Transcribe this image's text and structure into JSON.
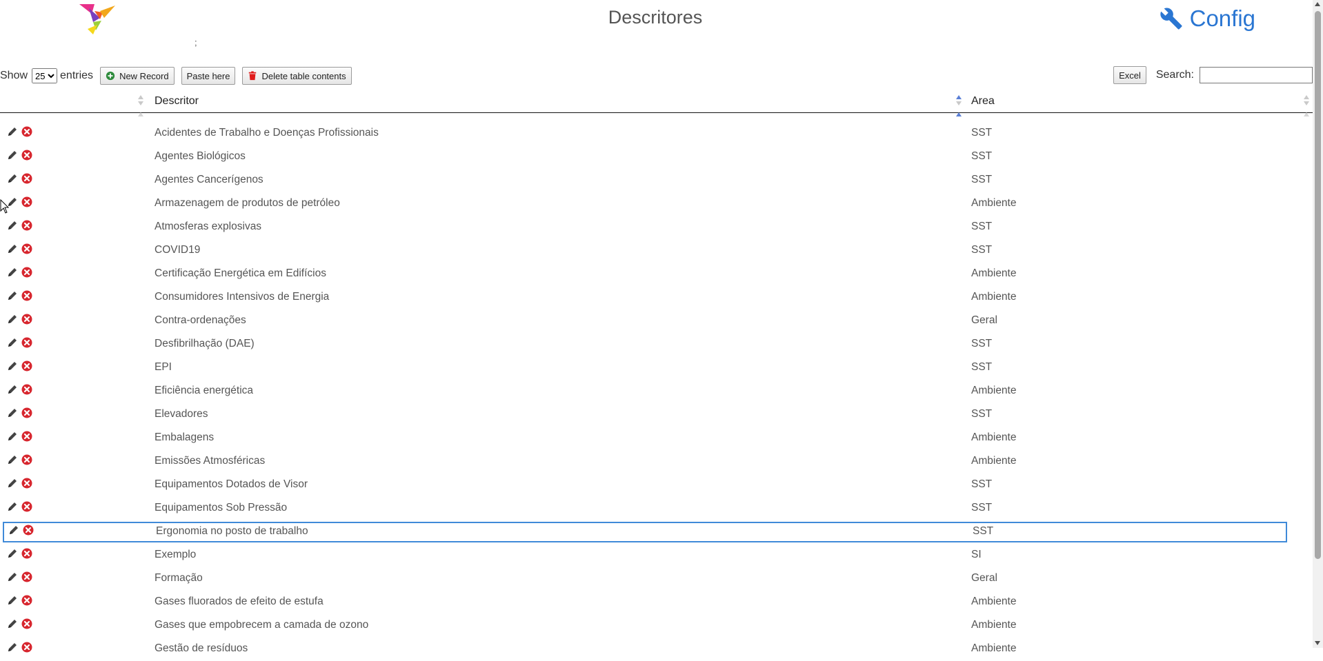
{
  "header": {
    "title": "Descritores",
    "config_label": "Config",
    "semicolon": ";",
    "logo_icon": "tangram-bird-logo",
    "config_icon": "wrench-icon",
    "accent_color": "#2a76d2"
  },
  "toolbar": {
    "show_label": "Show",
    "entries_value": "25",
    "entries_label": "entries",
    "new_record_label": "New Record",
    "paste_label": "Paste here",
    "delete_label": "Delete table contents",
    "excel_label": "Excel",
    "search_label": "Search:",
    "search_value": ""
  },
  "table": {
    "columns": [
      "",
      "Descritor",
      "Area"
    ],
    "sorted_column": "Descritor",
    "sort_direction": "ascending",
    "rows": [
      {
        "descritor": "Acidentes de Trabalho e Doenças Profissionais",
        "area": "SST"
      },
      {
        "descritor": "Agentes Biológicos",
        "area": "SST"
      },
      {
        "descritor": "Agentes Cancerígenos",
        "area": "SST"
      },
      {
        "descritor": "Armazenagem de produtos de petróleo",
        "area": "Ambiente"
      },
      {
        "descritor": "Atmosferas explosivas",
        "area": "SST"
      },
      {
        "descritor": "COVID19",
        "area": "SST"
      },
      {
        "descritor": "Certificação Energética em Edifícios",
        "area": "Ambiente"
      },
      {
        "descritor": "Consumidores Intensivos de Energia",
        "area": "Ambiente"
      },
      {
        "descritor": "Contra-ordenações",
        "area": "Geral"
      },
      {
        "descritor": "Desfibrilhação (DAE)",
        "area": "SST"
      },
      {
        "descritor": "EPI",
        "area": "SST"
      },
      {
        "descritor": "Eficiência energética",
        "area": "Ambiente"
      },
      {
        "descritor": "Elevadores",
        "area": "SST"
      },
      {
        "descritor": "Embalagens",
        "area": "Ambiente"
      },
      {
        "descritor": "Emissões Atmosféricas",
        "area": "Ambiente"
      },
      {
        "descritor": "Equipamentos Dotados de Visor",
        "area": "SST"
      },
      {
        "descritor": "Equipamentos Sob Pressão",
        "area": "SST"
      },
      {
        "descritor": "Ergonomia no posto de trabalho",
        "area": "SST",
        "focused": true
      },
      {
        "descritor": "Exemplo",
        "area": "SI"
      },
      {
        "descritor": "Formação",
        "area": "Geral"
      },
      {
        "descritor": "Gases fluorados de efeito de estufa",
        "area": "Ambiente"
      },
      {
        "descritor": "Gases que empobrecem a camada de ozono",
        "area": "Ambiente"
      },
      {
        "descritor": "Gestão de resíduos",
        "area": "Ambiente"
      }
    ]
  }
}
